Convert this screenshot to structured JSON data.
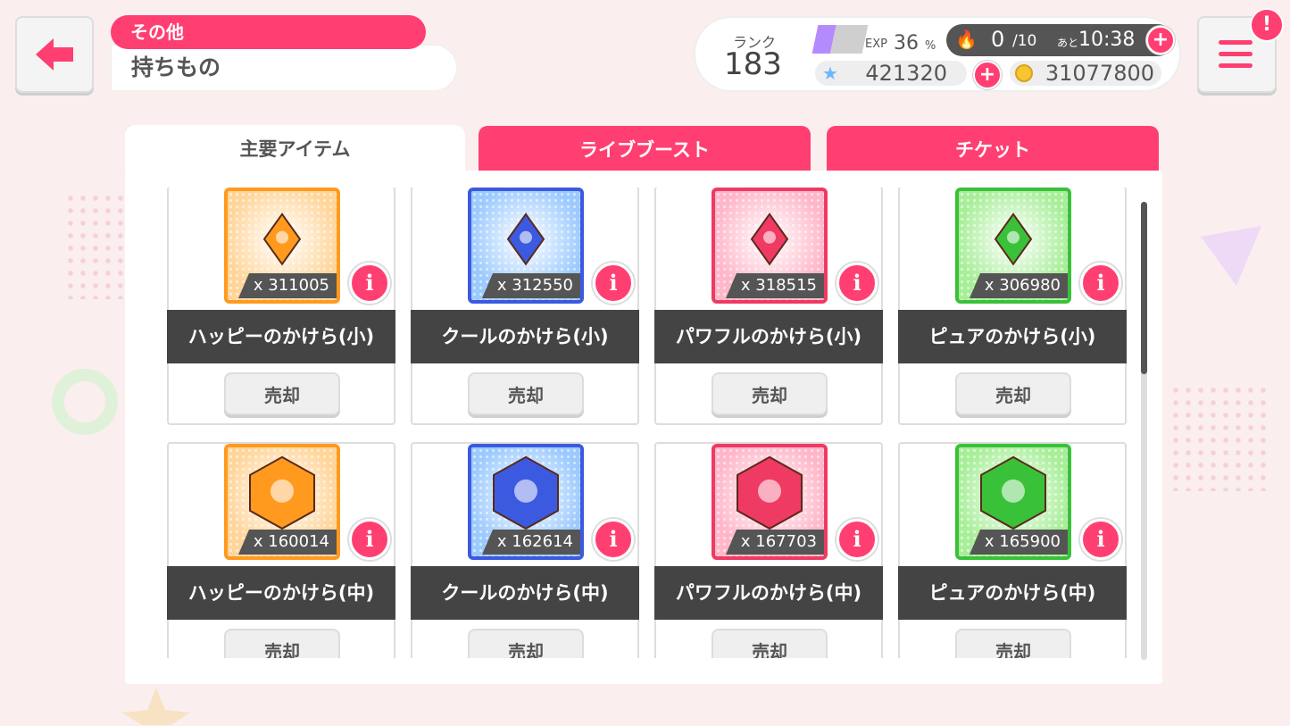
{
  "header": {
    "category": "その他",
    "title": "持ちもの"
  },
  "status": {
    "rank_label": "ランク",
    "rank": "183",
    "exp_label": "EXP",
    "exp_value": "36",
    "exp_unit": "%",
    "exp_progress": 0.36,
    "stamina_current": "0",
    "stamina_max": "/10",
    "stamina_timer_label": "あと",
    "stamina_timer": "10:38",
    "gems": "421320",
    "coins": "31077800",
    "plus_symbol": "+",
    "notify_symbol": "!"
  },
  "tabs": [
    {
      "label": "主要アイテム",
      "active": true
    },
    {
      "label": "ライブブースト",
      "active": false
    },
    {
      "label": "チケット",
      "active": false
    }
  ],
  "items": [
    {
      "name": "ハッピーのかけら(小)",
      "count": "x 311005",
      "color": "#ff9a1f",
      "bg": "#ffd59a",
      "sell": "売却"
    },
    {
      "name": "クールのかけら(小)",
      "count": "x 312550",
      "color": "#3c5ae0",
      "bg": "#9ccaff",
      "sell": "売却"
    },
    {
      "name": "パワフルのかけら(小)",
      "count": "x 318515",
      "color": "#ef3a63",
      "bg": "#ffb6c8",
      "sell": "売却"
    },
    {
      "name": "ピュアのかけら(小)",
      "count": "x 306980",
      "color": "#3ac13a",
      "bg": "#a8ee99",
      "sell": "売却"
    },
    {
      "name": "ハッピーのかけら(中)",
      "count": "x 160014",
      "color": "#ff9a1f",
      "bg": "#ffd59a",
      "sell": "売却"
    },
    {
      "name": "クールのかけら(中)",
      "count": "x 162614",
      "color": "#3c5ae0",
      "bg": "#9ccaff",
      "sell": "売却"
    },
    {
      "name": "パワフルのかけら(中)",
      "count": "x 167703",
      "color": "#ef3a63",
      "bg": "#ffb6c8",
      "sell": "売却"
    },
    {
      "name": "ピュアのかけら(中)",
      "count": "x 165900",
      "color": "#3ac13a",
      "bg": "#a8ee99",
      "sell": "売却"
    }
  ],
  "info_symbol": "i"
}
